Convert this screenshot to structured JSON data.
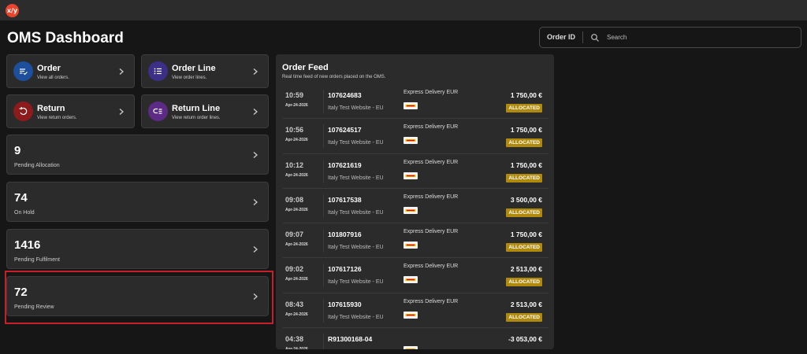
{
  "app": {
    "logo_text": "x/y",
    "page_title": "OMS Dashboard"
  },
  "search": {
    "scope_label": "Order ID",
    "placeholder": "Search"
  },
  "nav_cards": [
    {
      "title": "Order",
      "subtitle": "View all orders.",
      "icon": "order-list-icon",
      "color": "#1d4f9c"
    },
    {
      "title": "Order Line",
      "subtitle": "View order lines.",
      "icon": "list-icon",
      "color": "#3c2f8a"
    },
    {
      "title": "Return",
      "subtitle": "View return orders.",
      "icon": "return-icon",
      "color": "#8e1b1b"
    },
    {
      "title": "Return Line",
      "subtitle": "View return order lines.",
      "icon": "return-line-icon",
      "color": "#5d2b85"
    }
  ],
  "stat_cards": [
    {
      "value": "9",
      "label": "Pending Allocation"
    },
    {
      "value": "74",
      "label": "On Hold"
    },
    {
      "value": "1416",
      "label": "Pending Fulfilment"
    },
    {
      "value": "72",
      "label": "Pending Review"
    }
  ],
  "feed": {
    "title": "Order Feed",
    "subtitle": "Real time feed of new orders placed on the OMS.",
    "rows": [
      {
        "time": "10:59",
        "date": "Apr-24-2026",
        "order_id": "107624683",
        "site": "Italy Test Website - EU",
        "delivery": "Express Delivery EUR",
        "amount": "1 750,00 €",
        "status": "ALLOCATED"
      },
      {
        "time": "10:56",
        "date": "Apr-24-2026",
        "order_id": "107624517",
        "site": "Italy Test Website - EU",
        "delivery": "Express Delivery EUR",
        "amount": "1 750,00 €",
        "status": "ALLOCATED"
      },
      {
        "time": "10:12",
        "date": "Apr-24-2026",
        "order_id": "107621619",
        "site": "Italy Test Website - EU",
        "delivery": "Express Delivery EUR",
        "amount": "1 750,00 €",
        "status": "ALLOCATED"
      },
      {
        "time": "09:08",
        "date": "Apr-24-2026",
        "order_id": "107617538",
        "site": "Italy Test Website - EU",
        "delivery": "Express Delivery EUR",
        "amount": "3 500,00 €",
        "status": "ALLOCATED"
      },
      {
        "time": "09:07",
        "date": "Apr-24-2026",
        "order_id": "101807916",
        "site": "Italy Test Website - EU",
        "delivery": "Express Delivery EUR",
        "amount": "1 750,00 €",
        "status": "ALLOCATED"
      },
      {
        "time": "09:02",
        "date": "Apr-24-2026",
        "order_id": "107617126",
        "site": "Italy Test Website - EU",
        "delivery": "Express Delivery EUR",
        "amount": "2 513,00 €",
        "status": "ALLOCATED"
      },
      {
        "time": "08:43",
        "date": "Apr-24-2026",
        "order_id": "107615930",
        "site": "Italy Test Website - EU",
        "delivery": "Express Delivery EUR",
        "amount": "2 513,00 €",
        "status": "ALLOCATED"
      },
      {
        "time": "04:38",
        "date": "Apr-24-2026",
        "order_id": "R91300168-04",
        "site": "",
        "delivery": "",
        "amount": "-3 053,00 €",
        "status": ""
      }
    ]
  },
  "colors": {
    "allocated_badge": "#b08a0c",
    "highlight": "#c8202a"
  }
}
